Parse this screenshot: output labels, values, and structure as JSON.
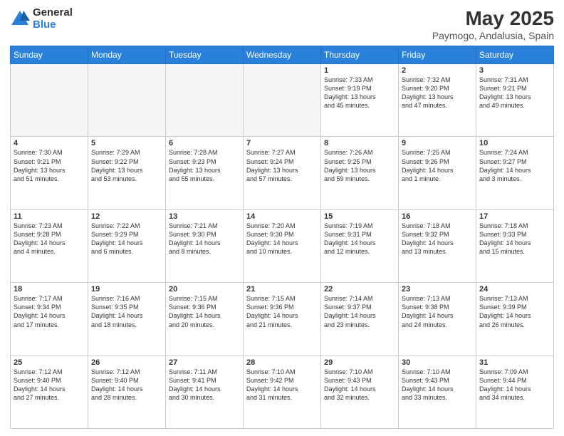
{
  "logo": {
    "general": "General",
    "blue": "Blue"
  },
  "title": {
    "month": "May 2025",
    "location": "Paymogo, Andalusia, Spain"
  },
  "weekdays": [
    "Sunday",
    "Monday",
    "Tuesday",
    "Wednesday",
    "Thursday",
    "Friday",
    "Saturday"
  ],
  "rows": [
    [
      {
        "day": "",
        "info": ""
      },
      {
        "day": "",
        "info": ""
      },
      {
        "day": "",
        "info": ""
      },
      {
        "day": "",
        "info": ""
      },
      {
        "day": "1",
        "info": "Sunrise: 7:33 AM\nSunset: 9:19 PM\nDaylight: 13 hours\nand 45 minutes."
      },
      {
        "day": "2",
        "info": "Sunrise: 7:32 AM\nSunset: 9:20 PM\nDaylight: 13 hours\nand 47 minutes."
      },
      {
        "day": "3",
        "info": "Sunrise: 7:31 AM\nSunset: 9:21 PM\nDaylight: 13 hours\nand 49 minutes."
      }
    ],
    [
      {
        "day": "4",
        "info": "Sunrise: 7:30 AM\nSunset: 9:21 PM\nDaylight: 13 hours\nand 51 minutes."
      },
      {
        "day": "5",
        "info": "Sunrise: 7:29 AM\nSunset: 9:22 PM\nDaylight: 13 hours\nand 53 minutes."
      },
      {
        "day": "6",
        "info": "Sunrise: 7:28 AM\nSunset: 9:23 PM\nDaylight: 13 hours\nand 55 minutes."
      },
      {
        "day": "7",
        "info": "Sunrise: 7:27 AM\nSunset: 9:24 PM\nDaylight: 13 hours\nand 57 minutes."
      },
      {
        "day": "8",
        "info": "Sunrise: 7:26 AM\nSunset: 9:25 PM\nDaylight: 13 hours\nand 59 minutes."
      },
      {
        "day": "9",
        "info": "Sunrise: 7:25 AM\nSunset: 9:26 PM\nDaylight: 14 hours\nand 1 minute."
      },
      {
        "day": "10",
        "info": "Sunrise: 7:24 AM\nSunset: 9:27 PM\nDaylight: 14 hours\nand 3 minutes."
      }
    ],
    [
      {
        "day": "11",
        "info": "Sunrise: 7:23 AM\nSunset: 9:28 PM\nDaylight: 14 hours\nand 4 minutes."
      },
      {
        "day": "12",
        "info": "Sunrise: 7:22 AM\nSunset: 9:29 PM\nDaylight: 14 hours\nand 6 minutes."
      },
      {
        "day": "13",
        "info": "Sunrise: 7:21 AM\nSunset: 9:30 PM\nDaylight: 14 hours\nand 8 minutes."
      },
      {
        "day": "14",
        "info": "Sunrise: 7:20 AM\nSunset: 9:30 PM\nDaylight: 14 hours\nand 10 minutes."
      },
      {
        "day": "15",
        "info": "Sunrise: 7:19 AM\nSunset: 9:31 PM\nDaylight: 14 hours\nand 12 minutes."
      },
      {
        "day": "16",
        "info": "Sunrise: 7:18 AM\nSunset: 9:32 PM\nDaylight: 14 hours\nand 13 minutes."
      },
      {
        "day": "17",
        "info": "Sunrise: 7:18 AM\nSunset: 9:33 PM\nDaylight: 14 hours\nand 15 minutes."
      }
    ],
    [
      {
        "day": "18",
        "info": "Sunrise: 7:17 AM\nSunset: 9:34 PM\nDaylight: 14 hours\nand 17 minutes."
      },
      {
        "day": "19",
        "info": "Sunrise: 7:16 AM\nSunset: 9:35 PM\nDaylight: 14 hours\nand 18 minutes."
      },
      {
        "day": "20",
        "info": "Sunrise: 7:15 AM\nSunset: 9:36 PM\nDaylight: 14 hours\nand 20 minutes."
      },
      {
        "day": "21",
        "info": "Sunrise: 7:15 AM\nSunset: 9:36 PM\nDaylight: 14 hours\nand 21 minutes."
      },
      {
        "day": "22",
        "info": "Sunrise: 7:14 AM\nSunset: 9:37 PM\nDaylight: 14 hours\nand 23 minutes."
      },
      {
        "day": "23",
        "info": "Sunrise: 7:13 AM\nSunset: 9:38 PM\nDaylight: 14 hours\nand 24 minutes."
      },
      {
        "day": "24",
        "info": "Sunrise: 7:13 AM\nSunset: 9:39 PM\nDaylight: 14 hours\nand 26 minutes."
      }
    ],
    [
      {
        "day": "25",
        "info": "Sunrise: 7:12 AM\nSunset: 9:40 PM\nDaylight: 14 hours\nand 27 minutes."
      },
      {
        "day": "26",
        "info": "Sunrise: 7:12 AM\nSunset: 9:40 PM\nDaylight: 14 hours\nand 28 minutes."
      },
      {
        "day": "27",
        "info": "Sunrise: 7:11 AM\nSunset: 9:41 PM\nDaylight: 14 hours\nand 30 minutes."
      },
      {
        "day": "28",
        "info": "Sunrise: 7:10 AM\nSunset: 9:42 PM\nDaylight: 14 hours\nand 31 minutes."
      },
      {
        "day": "29",
        "info": "Sunrise: 7:10 AM\nSunset: 9:43 PM\nDaylight: 14 hours\nand 32 minutes."
      },
      {
        "day": "30",
        "info": "Sunrise: 7:10 AM\nSunset: 9:43 PM\nDaylight: 14 hours\nand 33 minutes."
      },
      {
        "day": "31",
        "info": "Sunrise: 7:09 AM\nSunset: 9:44 PM\nDaylight: 14 hours\nand 34 minutes."
      }
    ]
  ]
}
